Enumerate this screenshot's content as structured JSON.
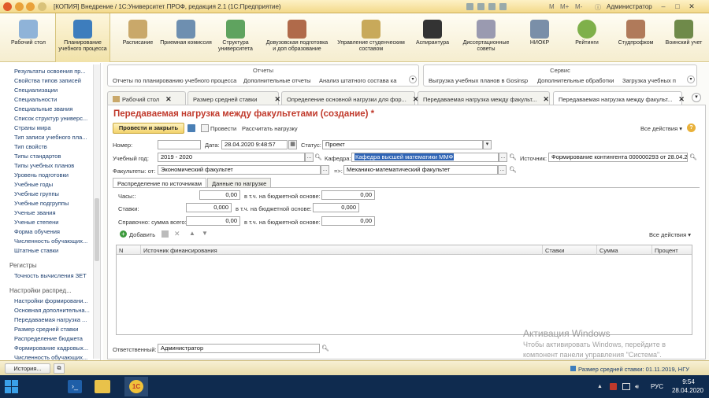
{
  "window": {
    "title": "[КОПИЯ] Внедрение / 1С:Университет ПРОФ, редакция 2.1  (1С:Предприятие)",
    "toolbar_m": "M",
    "toolbar_mplus": "M+",
    "toolbar_mminus": "M-",
    "user": "Администратор"
  },
  "ribbon": [
    {
      "label": "Рабочий стол"
    },
    {
      "label": "Планирование учебного процесса"
    },
    {
      "label": "Расписание"
    },
    {
      "label": "Приемная комиссия"
    },
    {
      "label": "Структура университета"
    },
    {
      "label": "Довузовская подготовка и доп образование"
    },
    {
      "label": "Управление студенческим составом"
    },
    {
      "label": "Аспирантура"
    },
    {
      "label": "Диссертационные советы"
    },
    {
      "label": "НИОКР"
    },
    {
      "label": "Рейтинги"
    },
    {
      "label": "Студпрофком"
    },
    {
      "label": "Воинский учет"
    }
  ],
  "sidebar": {
    "items": [
      "Результаты освоения пр...",
      "Свойства типов записей",
      "Специализации",
      "Специальности",
      "Специальные звания",
      "Список структур универс...",
      "Страны мира",
      "Тип записи учебного пла...",
      "Тип свойств",
      "Типы стандартов",
      "Типы учебных планов",
      "Уровень подготовки",
      "Учебные годы",
      "Учебные группы",
      "Учебные подгруппы",
      "Ученые звания",
      "Ученые степени",
      "Форма обучения",
      "Численность обучающих...",
      "Штатные ставки"
    ],
    "registers_title": "Регистры",
    "registers": [
      "Точность вычисления ЗЕТ"
    ],
    "settings_title": "Настройки распред...",
    "settings": [
      "Настройки формировани...",
      "Основная дополнительна...",
      "Передаваемая нагрузка ...",
      "Размер средней ставки",
      "Распределение бюджета",
      "Формирование кадровых...",
      "Численность обучающих..."
    ]
  },
  "panels": {
    "reports": {
      "title": "Отчеты",
      "links": [
        "Отчеты по планированию учебного процесса",
        "Дополнительные отчеты",
        "Анализ штатного состава ка"
      ]
    },
    "service": {
      "title": "Сервис",
      "links": [
        "Выгрузка учебных планов в Gosinsp",
        "Дополнительные обработки",
        "Загрузка учебных п"
      ]
    }
  },
  "tabs": [
    {
      "label": "Рабочий стол"
    },
    {
      "label": "Размер средней ставки"
    },
    {
      "label": "Определение основной нагрузки для фор..."
    },
    {
      "label": "Передаваемая нагрузка между факульт..."
    },
    {
      "label": "Передаваемая нагрузка между факульт..."
    }
  ],
  "form": {
    "title": "Передаваемая нагрузка между факультетами (создание) *",
    "btn_post_close": "Провести и закрыть",
    "btn_post": "Провести",
    "btn_calc": "Рассчитать нагрузку",
    "all_actions": "Все действия",
    "number_label": "Номер:",
    "number_value": "",
    "date_label": "Дата:",
    "date_value": "28.04.2020  9:48:57",
    "status_label": "Статус:",
    "status_value": "Проект",
    "year_label": "Учебный год:",
    "year_value": "2019 - 2020",
    "dept_label": "Кафедра:",
    "dept_value": "Кафедра высшей математики ММФ",
    "source_label": "Источник:",
    "source_value": "Формирование контингента 000000293 от 28.04.202",
    "fac_from_label": "Факультеты: от:",
    "fac_from_value": "Экономический факультет",
    "fac_to_label": "=>:",
    "fac_to_value": "Механико-математический факультет",
    "subtabs": [
      "Распределение по источникам",
      "Данные по нагрузке"
    ],
    "hours_label": "Часы::",
    "hours_value": "0,00",
    "hours_budget_label": "в т.ч. на бюджетной основе:",
    "hours_budget_value": "0,00",
    "rates_label": "Ставки:",
    "rates_value": "0,000",
    "rates_budget_label": "в т.ч. на бюджетной основе:",
    "rates_budget_value": "0,000",
    "sum_label": "Справочно: сумма всего:",
    "sum_value": "0,00",
    "sum_budget_label": "в т.ч. на бюджетной основе:",
    "sum_budget_value": "0,00",
    "add_label": "Добавить",
    "grid_all_actions": "Все действия",
    "columns": [
      "N",
      "Источник финансирования",
      "Ставки",
      "Сумма",
      "Процент"
    ],
    "responsible_label": "Ответственный:",
    "responsible_value": "Администратор"
  },
  "statusbar": {
    "history": "История...",
    "info": "Размер средней ставки: 01.11.2019, НГУ"
  },
  "watermark": {
    "line1": "Активация Windows",
    "line2": "Чтобы активировать Windows, перейдите в",
    "line3": "компонент панели управления \"Система\"."
  },
  "taskbar": {
    "lang": "РУС",
    "time": "9:54",
    "date": "28.04.2020"
  }
}
